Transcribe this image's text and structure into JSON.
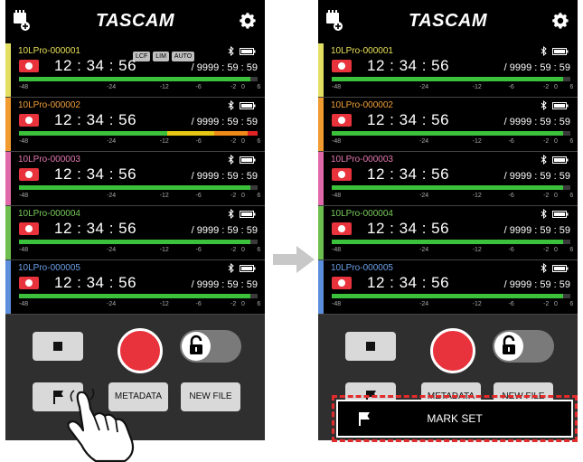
{
  "brand": "TASCAM",
  "colors": {
    "record_red": "#e8323c",
    "meter_green": "#3cc13c",
    "meter_yellow": "#e6c814",
    "meter_orange": "#ef8a18",
    "meter_red": "#e02424",
    "highlight_red": "#e22b2b"
  },
  "meter_scale": [
    "-48",
    "-24",
    "-12",
    "-6",
    "-2",
    "0",
    "6"
  ],
  "left": {
    "tracks": [
      {
        "file_name": "10LPro-000001",
        "name_color": "#e8e05a",
        "strip_color": "#e3df63",
        "badges": [
          "LCF",
          "LIM",
          "AUTO"
        ],
        "elapsed": "12 : 34 : 56",
        "total": "/ 9999 : 59 : 59",
        "meter": {
          "level_fraction": 0.97,
          "segments": [
            "green"
          ]
        }
      },
      {
        "file_name": "10LPro-000002",
        "name_color": "#f2a03d",
        "strip_color": "#f09a2f",
        "badges": [],
        "elapsed": "12 : 34 : 56",
        "total": "/ 9999 : 59 : 59",
        "meter": {
          "level_fraction": 1.0,
          "segments": [
            "green",
            "yellow",
            "orange",
            "red"
          ]
        }
      },
      {
        "file_name": "10LPro-000003",
        "name_color": "#e579b2",
        "strip_color": "#e06aa9",
        "badges": [],
        "elapsed": "12 : 34 : 56",
        "total": "/ 9999 : 59 : 59",
        "meter": {
          "level_fraction": 0.97,
          "segments": [
            "green"
          ]
        }
      },
      {
        "file_name": "10LPro-000004",
        "name_color": "#79cc5a",
        "strip_color": "#6cbf4e",
        "badges": [],
        "elapsed": "12 : 34 : 56",
        "total": "/ 9999 : 59 : 59",
        "meter": {
          "level_fraction": 0.97,
          "segments": [
            "green"
          ]
        }
      },
      {
        "file_name": "10LPro-000005",
        "name_color": "#6b9fe6",
        "strip_color": "#5b8fdc",
        "badges": [],
        "elapsed": "12 : 34 : 56",
        "total": "/ 9999 : 59 : 59",
        "meter": {
          "level_fraction": 0.97,
          "segments": [
            "green"
          ]
        }
      }
    ],
    "buttons": {
      "metadata": "METADATA",
      "new_file": "NEW FILE"
    }
  },
  "right": {
    "tracks": [
      {
        "file_name": "10LPro-000001",
        "name_color": "#e8e05a",
        "strip_color": "#e3df63",
        "badges": [],
        "elapsed": "12 : 34 : 56",
        "total": "/ 9999 : 59 : 59",
        "meter": {
          "level_fraction": 0.97,
          "segments": [
            "green"
          ]
        }
      },
      {
        "file_name": "10LPro-000002",
        "name_color": "#f2a03d",
        "strip_color": "#f09a2f",
        "badges": [],
        "elapsed": "12 : 34 : 56",
        "total": "/ 9999 : 59 : 59",
        "meter": {
          "level_fraction": 0.97,
          "segments": [
            "green"
          ]
        }
      },
      {
        "file_name": "10LPro-000003",
        "name_color": "#e579b2",
        "strip_color": "#e06aa9",
        "badges": [],
        "elapsed": "12 : 34 : 56",
        "total": "/ 9999 : 59 : 59",
        "meter": {
          "level_fraction": 0.97,
          "segments": [
            "green"
          ]
        }
      },
      {
        "file_name": "10LPro-000004",
        "name_color": "#79cc5a",
        "strip_color": "#6cbf4e",
        "badges": [],
        "elapsed": "12 : 34 : 56",
        "total": "/ 9999 : 59 : 59",
        "meter": {
          "level_fraction": 0.97,
          "segments": [
            "green"
          ]
        }
      },
      {
        "file_name": "10LPro-000005",
        "name_color": "#6b9fe6",
        "strip_color": "#5b8fdc",
        "badges": [],
        "elapsed": "12 : 34 : 56",
        "total": "/ 9999 : 59 : 59",
        "meter": {
          "level_fraction": 0.97,
          "segments": [
            "green"
          ]
        }
      }
    ],
    "buttons": {
      "metadata": "METADATA",
      "new_file": "NEW FILE"
    },
    "popup": {
      "label": "MARK SET",
      "icon": "flag-icon"
    }
  },
  "transition": {
    "icon": "right-arrow-icon"
  },
  "gesture": {
    "icon": "tap-hand-icon"
  }
}
